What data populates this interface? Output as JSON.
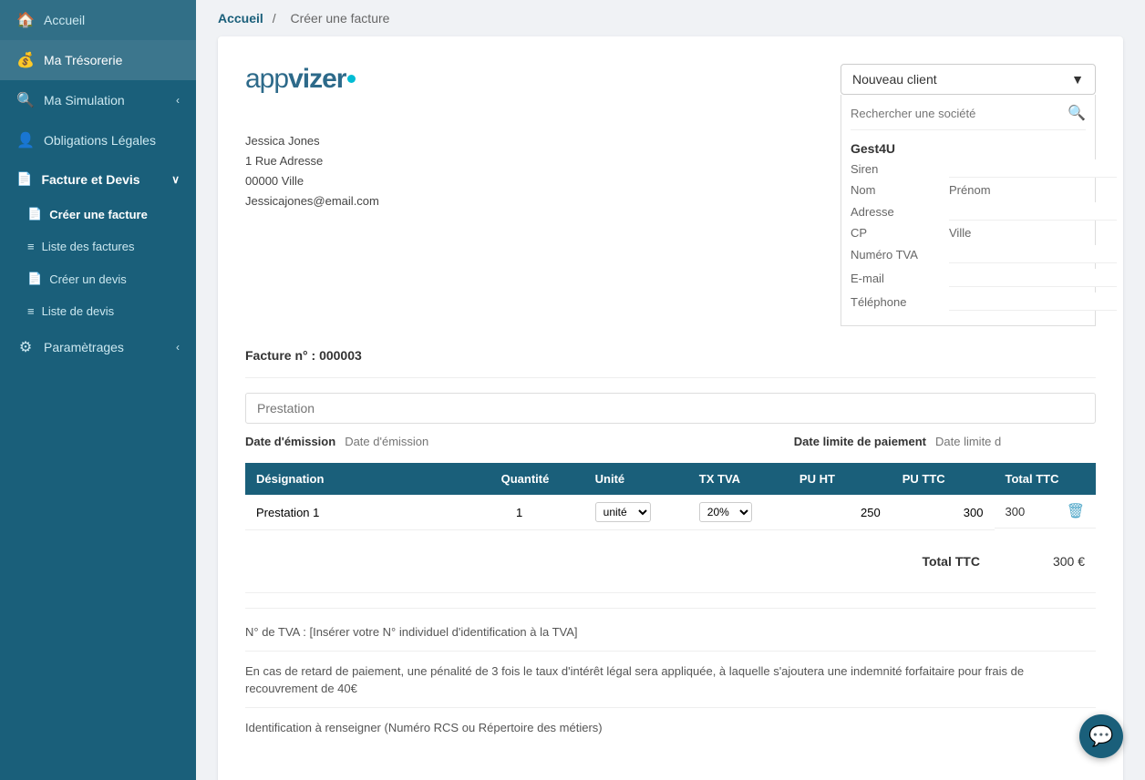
{
  "sidebar": {
    "items": [
      {
        "id": "accueil",
        "label": "Accueil",
        "icon": "🏠",
        "active": false
      },
      {
        "id": "ma-tresorerie",
        "label": "Ma Trésorerie",
        "icon": "💰",
        "active": false
      },
      {
        "id": "ma-simulation",
        "label": "Ma Simulation",
        "icon": "🔍",
        "active": false,
        "chevron": "‹"
      },
      {
        "id": "obligations-legales",
        "label": "Obligations Légales",
        "icon": "👤",
        "active": false
      },
      {
        "id": "facture-et-devis",
        "label": "Facture et Devis",
        "icon": "📄",
        "active": true,
        "chevron": "∨"
      },
      {
        "id": "creer-une-facture",
        "label": "Créer une facture",
        "icon": "📄",
        "active": true,
        "sub": true
      },
      {
        "id": "liste-des-factures",
        "label": "Liste des factures",
        "icon": "≡",
        "sub": true
      },
      {
        "id": "creer-un-devis",
        "label": "Créer un devis",
        "icon": "📄",
        "sub": true
      },
      {
        "id": "liste-de-devis",
        "label": "Liste de devis",
        "icon": "≡",
        "sub": true
      },
      {
        "id": "parametrages",
        "label": "Paramètrages",
        "icon": "⚙",
        "active": false,
        "chevron": "‹"
      }
    ]
  },
  "breadcrumb": {
    "home": "Accueil",
    "separator": "/",
    "current": "Créer une facture"
  },
  "invoice": {
    "logo": "appvizer",
    "sender": {
      "name": "Jessica Jones",
      "address": "1 Rue Adresse",
      "city": "00000 Ville",
      "email": "Jessicajones@email.com"
    },
    "client_dropdown": "Nouveau client",
    "client_dropdown_arrow": "▼",
    "search_placeholder": "Rechercher une société",
    "gest4u": "Gest4U",
    "fields": {
      "siren_label": "Siren",
      "nom_label": "Nom",
      "prenom_label": "Prénom",
      "adresse_label": "Adresse",
      "cp_label": "CP",
      "ville_label": "Ville",
      "tva_label": "Numéro TVA",
      "email_label": "E-mail",
      "telephone_label": "Téléphone"
    },
    "number_label": "Facture n° :",
    "number_value": "000003",
    "prestation_placeholder": "Prestation",
    "date_emission_label": "Date d'émission",
    "date_emission_placeholder": "Date d'émission",
    "date_limite_label": "Date limite de paiement",
    "date_limite_placeholder": "Date limite d",
    "table": {
      "headers": [
        "Désignation",
        "Quantité",
        "Unité",
        "TX TVA",
        "PU HT",
        "PU TTC",
        "Total TTC"
      ],
      "rows": [
        {
          "designation": "Prestation 1",
          "quantite": "1",
          "unite": "unité",
          "tx_tva": "20%",
          "pu_ht": "250",
          "pu_ttc": "300",
          "total_ttc": "300"
        }
      ]
    },
    "total_label": "Total TTC",
    "total_value": "300 €",
    "notes": [
      "N° de TVA : [Insérer votre N° individuel d'identification à la TVA]",
      "En cas de retard de paiement, une pénalité de 3 fois le taux d'intérêt légal sera appliquée, à laquelle s'ajoutera une indemnité forfaitaire pour frais de recouvrement de 40€",
      "Identification à renseigner (Numéro RCS ou Répertoire des métiers)"
    ]
  }
}
